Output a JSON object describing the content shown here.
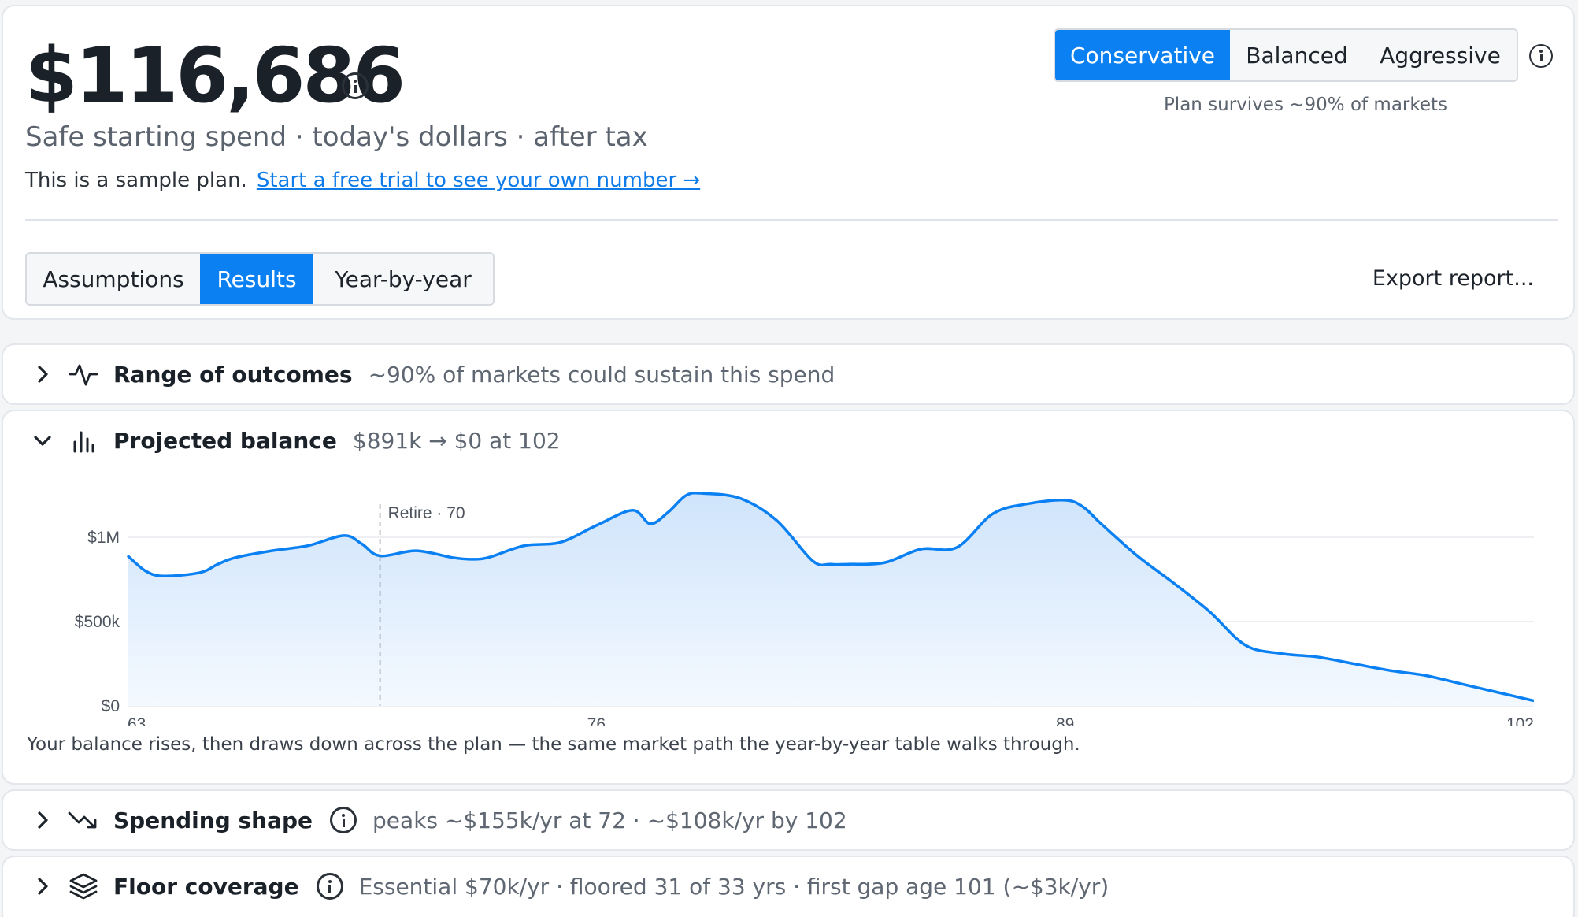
{
  "hero": {
    "amount": "$116,686",
    "subtitle": "Safe starting spend · today's dollars · after tax",
    "sample_text": "This is a sample plan.",
    "trial_link": "Start a free trial to see your own number →",
    "risk_options": [
      "Conservative",
      "Balanced",
      "Aggressive"
    ],
    "risk_selected": "Conservative",
    "survives": "Plan survives ~90% of markets",
    "view_tabs": [
      "Assumptions",
      "Results",
      "Year-by-year"
    ],
    "view_selected": "Results",
    "export": "Export report..."
  },
  "sections": {
    "range": {
      "title": "Range of outcomes",
      "summary": "~90% of markets could sustain this spend",
      "icon": "activity-icon"
    },
    "balance": {
      "title": "Projected balance",
      "summary": "$891k → $0 at 102",
      "icon": "bar-chart-icon",
      "caption": "Your balance rises, then draws down across the plan — the same market path the year-by-year table walks through."
    },
    "spend": {
      "title": "Spending shape",
      "summary": "peaks ~$155k/yr at 72 · ~$108k/yr by 102",
      "icon": "trending-down-icon"
    },
    "floor": {
      "title": "Floor coverage",
      "summary": "Essential $70k/yr · floored 31 of 33 yrs · first gap age 101 (~$3k/yr)",
      "icon": "layers-icon"
    }
  },
  "colors": {
    "accent": "#0a80f2",
    "area_top": "#cfe4fb",
    "area_bottom": "#f4f9ff"
  },
  "chart_data": {
    "type": "area",
    "title": "",
    "xlabel": "",
    "ylabel": "",
    "x_ticks": [
      "63",
      "76",
      "89",
      "102"
    ],
    "y_ticks": [
      "$0",
      "$500k",
      "$1M"
    ],
    "xlim": [
      63,
      102
    ],
    "ylim": [
      0,
      1000000
    ],
    "annotation": {
      "label": "Retire · 70",
      "x": 70
    },
    "series": [
      {
        "x": [
          63,
          63.5,
          64,
          65,
          65.5,
          66,
          67,
          68,
          69,
          69.5,
          70,
          71,
          72,
          72.5,
          73,
          74,
          75,
          76,
          77,
          77.5,
          78,
          78.5,
          79,
          80,
          81,
          82,
          82.5,
          83,
          84,
          85,
          86,
          87,
          88,
          89,
          89.5,
          90,
          91,
          92,
          93,
          94,
          95,
          96,
          97,
          98,
          99,
          100,
          101,
          102
        ],
        "y": [
          891000,
          800000,
          770000,
          790000,
          840000,
          880000,
          920000,
          950000,
          1010000,
          960000,
          890000,
          920000,
          880000,
          870000,
          880000,
          950000,
          970000,
          1070000,
          1160000,
          1080000,
          1150000,
          1250000,
          1260000,
          1230000,
          1100000,
          860000,
          840000,
          840000,
          850000,
          930000,
          940000,
          1140000,
          1200000,
          1220000,
          1180000,
          1080000,
          890000,
          730000,
          560000,
          360000,
          310000,
          290000,
          250000,
          210000,
          180000,
          130000,
          80000,
          30000
        ]
      }
    ]
  }
}
